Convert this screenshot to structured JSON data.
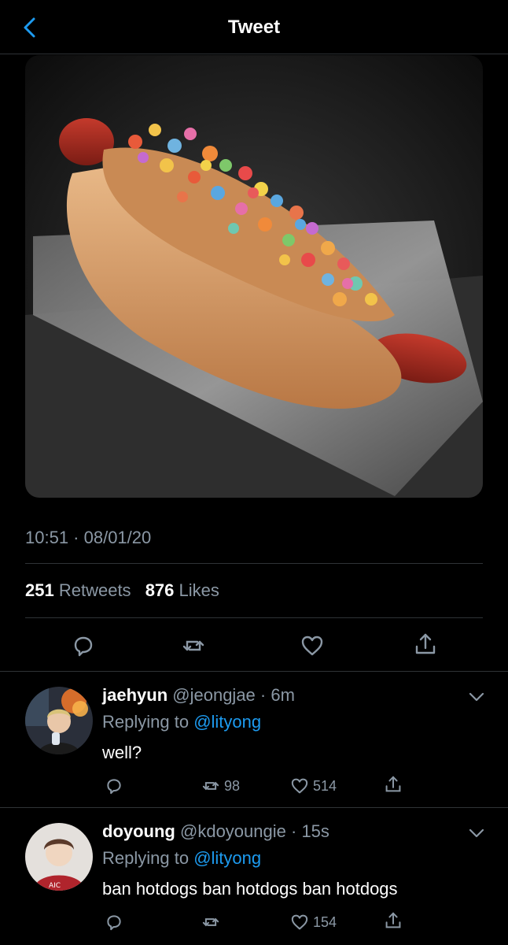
{
  "nav": {
    "title": "Tweet"
  },
  "tweet": {
    "timestamp": "10:51 · 08/01/20",
    "retweets_count": "251",
    "retweets_label": "Retweets",
    "likes_count": "876",
    "likes_label": "Likes"
  },
  "replies": [
    {
      "name": "jaehyun",
      "handle": "@jeongjae",
      "time": "· 6m",
      "replying_prefix": "Replying to",
      "replying_to": "@lityong",
      "text": "well?",
      "retweets": "98",
      "likes": "514"
    },
    {
      "name": "doyoung",
      "handle": "@kdoyoungie",
      "time": "· 15s",
      "replying_prefix": "Replying to",
      "replying_to": "@lityong",
      "text": "ban hotdogs ban hotdogs ban hotdogs",
      "retweets": "",
      "likes": "154"
    }
  ],
  "colors": {
    "accent": "#1d9bf0",
    "muted": "#8b98a5",
    "divider": "#2f3336",
    "background": "#000000"
  },
  "icons": [
    "back-chevron-icon",
    "reply-icon",
    "retweet-icon",
    "like-icon",
    "share-icon",
    "chevron-down-icon"
  ]
}
